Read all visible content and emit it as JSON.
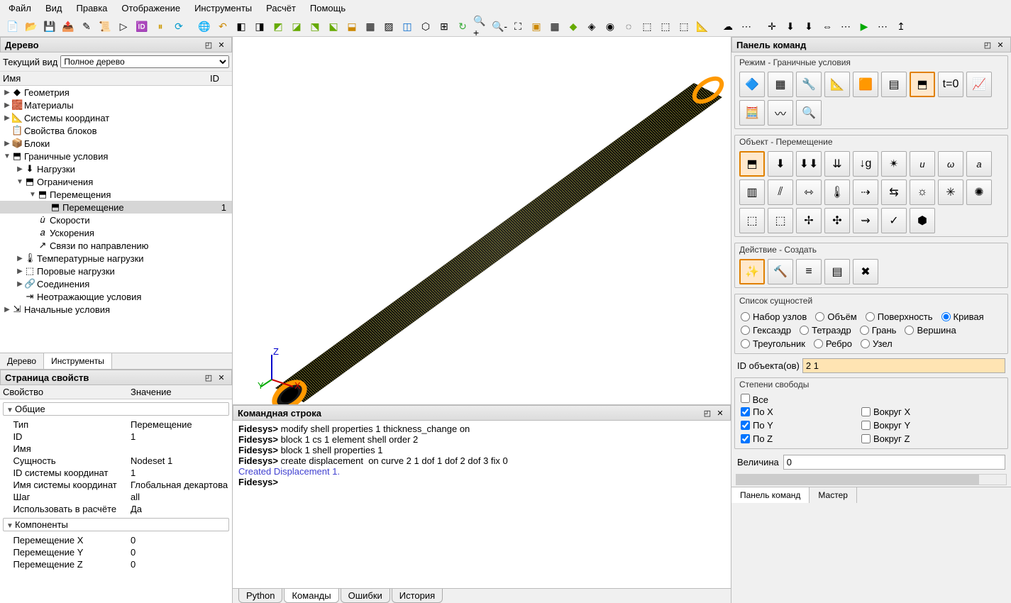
{
  "menubar": [
    "Файл",
    "Вид",
    "Правка",
    "Отображение",
    "Инструменты",
    "Расчёт",
    "Помощь"
  ],
  "panels": {
    "tree_title": "Дерево",
    "props_title": "Страница свойств",
    "cmd_title": "Командная строка",
    "right_title": "Панель команд"
  },
  "tree": {
    "view_label": "Текущий вид",
    "view_value": "Полное дерево",
    "col_name": "Имя",
    "col_id": "ID",
    "items": [
      {
        "ind": 0,
        "exp": "▶",
        "ico": "◆",
        "lbl": "Геометрия",
        "id": ""
      },
      {
        "ind": 0,
        "exp": "▶",
        "ico": "🧱",
        "lbl": "Материалы",
        "id": ""
      },
      {
        "ind": 0,
        "exp": "▶",
        "ico": "📐",
        "lbl": "Системы координат",
        "id": ""
      },
      {
        "ind": 0,
        "exp": "",
        "ico": "📋",
        "lbl": "Свойства блоков",
        "id": ""
      },
      {
        "ind": 0,
        "exp": "▶",
        "ico": "📦",
        "lbl": "Блоки",
        "id": ""
      },
      {
        "ind": 0,
        "exp": "▼",
        "ico": "⬒",
        "lbl": "Граничные условия",
        "id": ""
      },
      {
        "ind": 1,
        "exp": "▶",
        "ico": "⬇",
        "lbl": "Нагрузки",
        "id": ""
      },
      {
        "ind": 1,
        "exp": "▼",
        "ico": "⬒",
        "lbl": "Ограничения",
        "id": ""
      },
      {
        "ind": 2,
        "exp": "▼",
        "ico": "⬒",
        "lbl": "Перемещения",
        "id": ""
      },
      {
        "ind": 3,
        "exp": "",
        "ico": "⬒",
        "lbl": "Перемещение",
        "id": "1",
        "sel": true
      },
      {
        "ind": 2,
        "exp": "",
        "ico": "𝑢̇",
        "lbl": "Скорости",
        "id": ""
      },
      {
        "ind": 2,
        "exp": "",
        "ico": "𝑎",
        "lbl": "Ускорения",
        "id": ""
      },
      {
        "ind": 2,
        "exp": "",
        "ico": "↗",
        "lbl": "Связи по направлению",
        "id": ""
      },
      {
        "ind": 1,
        "exp": "▶",
        "ico": "🌡",
        "lbl": "Температурные нагрузки",
        "id": ""
      },
      {
        "ind": 1,
        "exp": "▶",
        "ico": "⬚",
        "lbl": "Поровые нагрузки",
        "id": ""
      },
      {
        "ind": 1,
        "exp": "▶",
        "ico": "🔗",
        "lbl": "Соединения",
        "id": ""
      },
      {
        "ind": 1,
        "exp": "",
        "ico": "⇥",
        "lbl": "Неотражающие условия",
        "id": ""
      },
      {
        "ind": 0,
        "exp": "▶",
        "ico": "⇲",
        "lbl": "Начальные условия",
        "id": ""
      }
    ],
    "tabs": [
      "Дерево",
      "Инструменты"
    ]
  },
  "props": {
    "col1": "Свойство",
    "col2": "Значение",
    "rows": [
      {
        "g": true,
        "k": "Общие",
        "v": ""
      },
      {
        "k": "Тип",
        "v": "Перемещение"
      },
      {
        "k": "ID",
        "v": "1"
      },
      {
        "k": "Имя",
        "v": ""
      },
      {
        "k": "Сущность",
        "v": "Nodeset 1"
      },
      {
        "k": "ID системы координат",
        "v": "1"
      },
      {
        "k": "Имя системы координат",
        "v": "Глобальная декартова"
      },
      {
        "k": "Шаг",
        "v": "all"
      },
      {
        "k": "Использовать в расчёте",
        "v": "Да"
      },
      {
        "g": true,
        "k": "Компоненты",
        "v": ""
      },
      {
        "k": "Перемещение X",
        "v": "0"
      },
      {
        "k": "Перемещение Y",
        "v": "0"
      },
      {
        "k": "Перемещение Z",
        "v": "0"
      }
    ]
  },
  "cmd": {
    "lines": [
      {
        "p": "Fidesys>",
        "t": " modify shell properties 1 thickness_change on"
      },
      {
        "p": "",
        "t": ""
      },
      {
        "p": "Fidesys>",
        "t": " block 1 cs 1 element shell order 2"
      },
      {
        "p": "",
        "t": ""
      },
      {
        "p": "Fidesys>",
        "t": " block 1 shell properties 1"
      },
      {
        "p": "",
        "t": ""
      },
      {
        "p": "Fidesys>",
        "t": " create displacement  on curve 2 1 dof 1 dof 2 dof 3 fix 0"
      },
      {
        "p": "",
        "t": ""
      },
      {
        "ok": true,
        "t": "Created Displacement 1."
      },
      {
        "p": "",
        "t": ""
      },
      {
        "p": "",
        "t": ""
      },
      {
        "p": "Fidesys>",
        "t": " "
      }
    ],
    "tabs": [
      "Python",
      "Команды",
      "Ошибки",
      "История"
    ]
  },
  "right": {
    "mode_title": "Режим - Граничные условия",
    "object_title": "Объект - Перемещение",
    "action_title": "Действие - Создать",
    "entity_title": "Список сущностей",
    "entity_opts": [
      "Набор узлов",
      "Объём",
      "Поверхность",
      "Кривая",
      "Гексаэдр",
      "Тетраэдр",
      "Грань",
      "Вершина",
      "Треугольник",
      "Ребро",
      "Узел"
    ],
    "id_label": "ID объекта(ов)",
    "id_value": "2 1",
    "dof_title": "Степени свободы",
    "dof_all": "Все",
    "dof_x": "По X",
    "dof_y": "По Y",
    "dof_z": "По Z",
    "dof_rx": "Вокруг X",
    "dof_ry": "Вокруг Y",
    "dof_rz": "Вокруг Z",
    "mag_label": "Величина",
    "mag_value": "0",
    "tabs": [
      "Панель команд",
      "Мастер"
    ]
  }
}
